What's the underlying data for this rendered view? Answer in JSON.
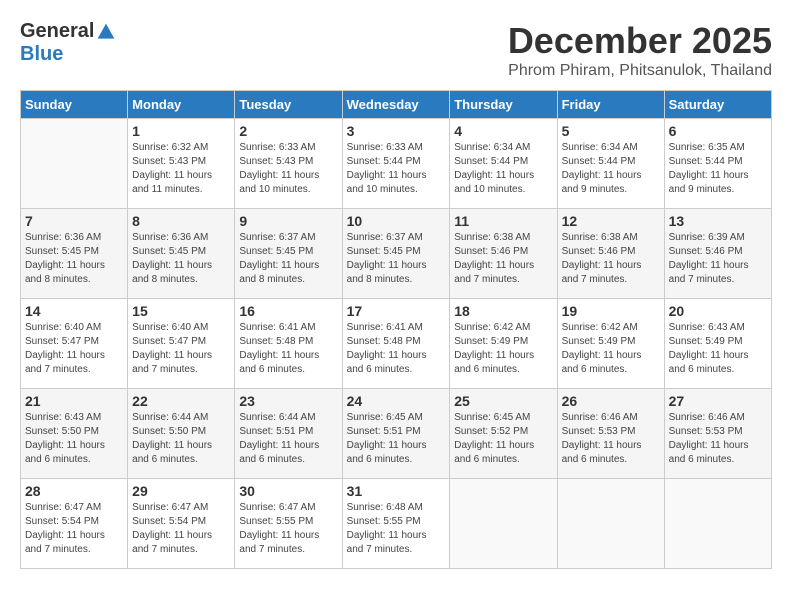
{
  "logo": {
    "general": "General",
    "blue": "Blue"
  },
  "title": {
    "month": "December 2025",
    "location": "Phrom Phiram, Phitsanulok, Thailand"
  },
  "headers": [
    "Sunday",
    "Monday",
    "Tuesday",
    "Wednesday",
    "Thursday",
    "Friday",
    "Saturday"
  ],
  "weeks": [
    [
      {
        "day": "",
        "sunrise": "",
        "sunset": "",
        "daylight": ""
      },
      {
        "day": "1",
        "sunrise": "Sunrise: 6:32 AM",
        "sunset": "Sunset: 5:43 PM",
        "daylight": "Daylight: 11 hours and 11 minutes."
      },
      {
        "day": "2",
        "sunrise": "Sunrise: 6:33 AM",
        "sunset": "Sunset: 5:43 PM",
        "daylight": "Daylight: 11 hours and 10 minutes."
      },
      {
        "day": "3",
        "sunrise": "Sunrise: 6:33 AM",
        "sunset": "Sunset: 5:44 PM",
        "daylight": "Daylight: 11 hours and 10 minutes."
      },
      {
        "day": "4",
        "sunrise": "Sunrise: 6:34 AM",
        "sunset": "Sunset: 5:44 PM",
        "daylight": "Daylight: 11 hours and 10 minutes."
      },
      {
        "day": "5",
        "sunrise": "Sunrise: 6:34 AM",
        "sunset": "Sunset: 5:44 PM",
        "daylight": "Daylight: 11 hours and 9 minutes."
      },
      {
        "day": "6",
        "sunrise": "Sunrise: 6:35 AM",
        "sunset": "Sunset: 5:44 PM",
        "daylight": "Daylight: 11 hours and 9 minutes."
      }
    ],
    [
      {
        "day": "7",
        "sunrise": "Sunrise: 6:36 AM",
        "sunset": "Sunset: 5:45 PM",
        "daylight": "Daylight: 11 hours and 8 minutes."
      },
      {
        "day": "8",
        "sunrise": "Sunrise: 6:36 AM",
        "sunset": "Sunset: 5:45 PM",
        "daylight": "Daylight: 11 hours and 8 minutes."
      },
      {
        "day": "9",
        "sunrise": "Sunrise: 6:37 AM",
        "sunset": "Sunset: 5:45 PM",
        "daylight": "Daylight: 11 hours and 8 minutes."
      },
      {
        "day": "10",
        "sunrise": "Sunrise: 6:37 AM",
        "sunset": "Sunset: 5:45 PM",
        "daylight": "Daylight: 11 hours and 8 minutes."
      },
      {
        "day": "11",
        "sunrise": "Sunrise: 6:38 AM",
        "sunset": "Sunset: 5:46 PM",
        "daylight": "Daylight: 11 hours and 7 minutes."
      },
      {
        "day": "12",
        "sunrise": "Sunrise: 6:38 AM",
        "sunset": "Sunset: 5:46 PM",
        "daylight": "Daylight: 11 hours and 7 minutes."
      },
      {
        "day": "13",
        "sunrise": "Sunrise: 6:39 AM",
        "sunset": "Sunset: 5:46 PM",
        "daylight": "Daylight: 11 hours and 7 minutes."
      }
    ],
    [
      {
        "day": "14",
        "sunrise": "Sunrise: 6:40 AM",
        "sunset": "Sunset: 5:47 PM",
        "daylight": "Daylight: 11 hours and 7 minutes."
      },
      {
        "day": "15",
        "sunrise": "Sunrise: 6:40 AM",
        "sunset": "Sunset: 5:47 PM",
        "daylight": "Daylight: 11 hours and 7 minutes."
      },
      {
        "day": "16",
        "sunrise": "Sunrise: 6:41 AM",
        "sunset": "Sunset: 5:48 PM",
        "daylight": "Daylight: 11 hours and 6 minutes."
      },
      {
        "day": "17",
        "sunrise": "Sunrise: 6:41 AM",
        "sunset": "Sunset: 5:48 PM",
        "daylight": "Daylight: 11 hours and 6 minutes."
      },
      {
        "day": "18",
        "sunrise": "Sunrise: 6:42 AM",
        "sunset": "Sunset: 5:49 PM",
        "daylight": "Daylight: 11 hours and 6 minutes."
      },
      {
        "day": "19",
        "sunrise": "Sunrise: 6:42 AM",
        "sunset": "Sunset: 5:49 PM",
        "daylight": "Daylight: 11 hours and 6 minutes."
      },
      {
        "day": "20",
        "sunrise": "Sunrise: 6:43 AM",
        "sunset": "Sunset: 5:49 PM",
        "daylight": "Daylight: 11 hours and 6 minutes."
      }
    ],
    [
      {
        "day": "21",
        "sunrise": "Sunrise: 6:43 AM",
        "sunset": "Sunset: 5:50 PM",
        "daylight": "Daylight: 11 hours and 6 minutes."
      },
      {
        "day": "22",
        "sunrise": "Sunrise: 6:44 AM",
        "sunset": "Sunset: 5:50 PM",
        "daylight": "Daylight: 11 hours and 6 minutes."
      },
      {
        "day": "23",
        "sunrise": "Sunrise: 6:44 AM",
        "sunset": "Sunset: 5:51 PM",
        "daylight": "Daylight: 11 hours and 6 minutes."
      },
      {
        "day": "24",
        "sunrise": "Sunrise: 6:45 AM",
        "sunset": "Sunset: 5:51 PM",
        "daylight": "Daylight: 11 hours and 6 minutes."
      },
      {
        "day": "25",
        "sunrise": "Sunrise: 6:45 AM",
        "sunset": "Sunset: 5:52 PM",
        "daylight": "Daylight: 11 hours and 6 minutes."
      },
      {
        "day": "26",
        "sunrise": "Sunrise: 6:46 AM",
        "sunset": "Sunset: 5:53 PM",
        "daylight": "Daylight: 11 hours and 6 minutes."
      },
      {
        "day": "27",
        "sunrise": "Sunrise: 6:46 AM",
        "sunset": "Sunset: 5:53 PM",
        "daylight": "Daylight: 11 hours and 6 minutes."
      }
    ],
    [
      {
        "day": "28",
        "sunrise": "Sunrise: 6:47 AM",
        "sunset": "Sunset: 5:54 PM",
        "daylight": "Daylight: 11 hours and 7 minutes."
      },
      {
        "day": "29",
        "sunrise": "Sunrise: 6:47 AM",
        "sunset": "Sunset: 5:54 PM",
        "daylight": "Daylight: 11 hours and 7 minutes."
      },
      {
        "day": "30",
        "sunrise": "Sunrise: 6:47 AM",
        "sunset": "Sunset: 5:55 PM",
        "daylight": "Daylight: 11 hours and 7 minutes."
      },
      {
        "day": "31",
        "sunrise": "Sunrise: 6:48 AM",
        "sunset": "Sunset: 5:55 PM",
        "daylight": "Daylight: 11 hours and 7 minutes."
      },
      {
        "day": "",
        "sunrise": "",
        "sunset": "",
        "daylight": ""
      },
      {
        "day": "",
        "sunrise": "",
        "sunset": "",
        "daylight": ""
      },
      {
        "day": "",
        "sunrise": "",
        "sunset": "",
        "daylight": ""
      }
    ]
  ]
}
